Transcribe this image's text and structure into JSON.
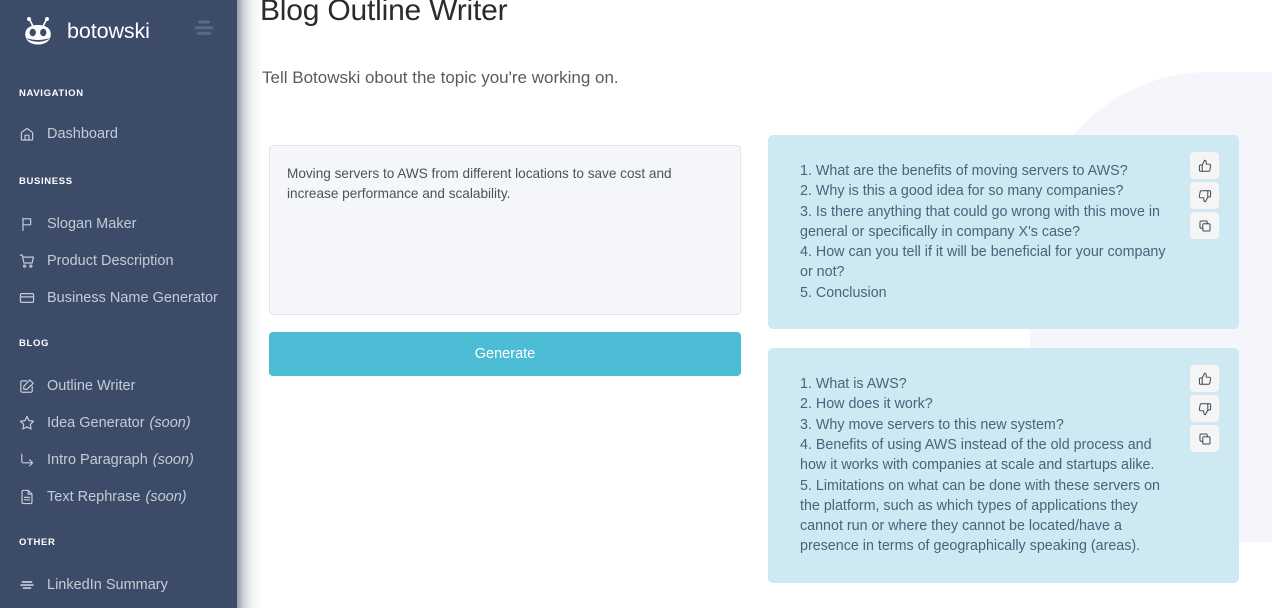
{
  "brand": {
    "name": "botowski",
    "logo_icon": "robot-face-icon",
    "menu_icon": "hamburger-menu-icon"
  },
  "sidebar": {
    "sections": [
      {
        "title": "NAVIGATION",
        "items": [
          {
            "label": "Dashboard",
            "icon": "home-icon",
            "soon": ""
          }
        ]
      },
      {
        "title": "BUSINESS",
        "items": [
          {
            "label": "Slogan Maker",
            "icon": "flag-icon",
            "soon": ""
          },
          {
            "label": "Product Description",
            "icon": "shopping-cart-icon",
            "soon": ""
          },
          {
            "label": "Business Name Generator",
            "icon": "credit-card-icon",
            "soon": ""
          }
        ]
      },
      {
        "title": "BLOG",
        "items": [
          {
            "label": "Outline Writer",
            "icon": "edit-square-icon",
            "soon": ""
          },
          {
            "label": "Idea Generator",
            "icon": "star-icon",
            "soon": "(soon)"
          },
          {
            "label": "Intro Paragraph",
            "icon": "corner-down-right-icon",
            "soon": "(soon)"
          },
          {
            "label": "Text Rephrase",
            "icon": "file-text-icon",
            "soon": "(soon)"
          }
        ]
      },
      {
        "title": "OTHER",
        "items": [
          {
            "label": "LinkedIn Summary",
            "icon": "align-lines-icon",
            "soon": ""
          }
        ]
      }
    ]
  },
  "main": {
    "title": "Blog Outline Writer",
    "subtitle": "Tell Botowski obout the topic you're working on.",
    "topic_input": {
      "value": "Moving servers to AWS from different locations to save cost and increase performance and scalability.",
      "placeholder": "Tell Botowski obout the topic you're working on."
    },
    "generate_label": "Generate"
  },
  "results": {
    "action_icons": [
      "thumbs-up-icon",
      "thumbs-down-icon",
      "copy-icon"
    ],
    "cards": [
      {
        "text": "1. What are the benefits of moving servers to AWS?\n2. Why is this a good idea for so many companies?\n3. Is there anything that could go wrong with this move in general or specifically in company X's case?\n4. How can you tell if it will be beneficial for your company or not?\n5. Conclusion"
      },
      {
        "text": "1. What is AWS?\n2. How does it work?\n3. Why move servers to this new system?\n4. Benefits of using AWS instead of the old process and how it works with companies at scale and startups alike.\n5. Limitations on what can be done with these servers on the platform, such as which types of applications they cannot run or where they cannot be located/have a presence in terms of geographically speaking (areas)."
      }
    ]
  },
  "colors": {
    "sidebar_bg": "#3c4c68",
    "accent_button": "#4cbdd4",
    "card_bg": "#cee9f2",
    "card_text": "#46657a",
    "deco_bg": "#f4f6fb"
  }
}
